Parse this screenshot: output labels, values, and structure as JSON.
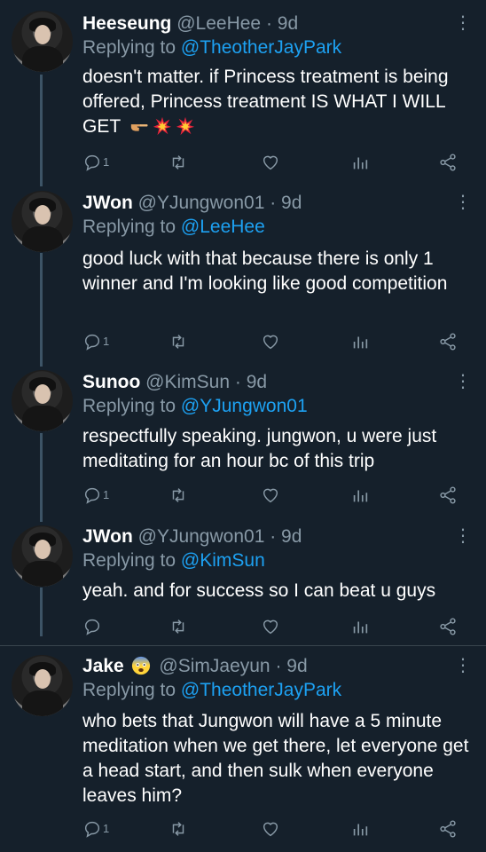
{
  "tweets": [
    {
      "name": "Heeseung",
      "handle": "@LeeHee",
      "dot": " · ",
      "time": "9d",
      "replying_prefix": "Replying to ",
      "replying_to": "@TheotherJayPark",
      "text": "doesn't matter. if Princess treatment is being offered, Princess treatment IS WHAT I WILL GET",
      "emojis": [
        "backhand-index-pointing-right",
        "collision",
        "collision"
      ],
      "reply_count": "1"
    },
    {
      "name": "JWon",
      "handle": "@YJungwon01",
      "dot": " · ",
      "time": "9d",
      "replying_prefix": "Replying to ",
      "replying_to": "@LeeHee",
      "text": "good luck with that because there is only 1 winner and I'm looking like good competition",
      "reply_count": "1"
    },
    {
      "name": "Sunoo",
      "handle": "@KimSun",
      "dot": " · ",
      "time": "9d",
      "replying_prefix": "Replying to ",
      "replying_to": "@YJungwon01",
      "text": "respectfully speaking. jungwon, u were just meditating for an hour bc of this trip",
      "reply_count": "1"
    },
    {
      "name": "JWon",
      "handle": "@YJungwon01",
      "dot": " · ",
      "time": "9d",
      "replying_prefix": "Replying to ",
      "replying_to": "@KimSun",
      "text": "yeah. and for success so I can beat u guys",
      "reply_count": ""
    },
    {
      "name": "Jake",
      "name_emoji": "fearful-face",
      "handle": "@SimJaeyun",
      "dot": " · ",
      "time": "9d",
      "replying_prefix": "Replying to ",
      "replying_to": "@TheotherJayPark",
      "text": "who bets that Jungwon will have a 5 minute meditation when we get there, let everyone get a head start, and then sulk when everyone leaves him?",
      "reply_count": "1"
    }
  ],
  "icons": {
    "reply": "reply-icon",
    "retweet": "retweet-icon",
    "like": "like-icon",
    "analytics": "analytics-icon",
    "share": "share-icon",
    "more": "more-vertical-icon"
  },
  "colors": {
    "background": "#15202b",
    "muted": "#8899a6",
    "link": "#1da1f2",
    "separator": "#38444d"
  }
}
